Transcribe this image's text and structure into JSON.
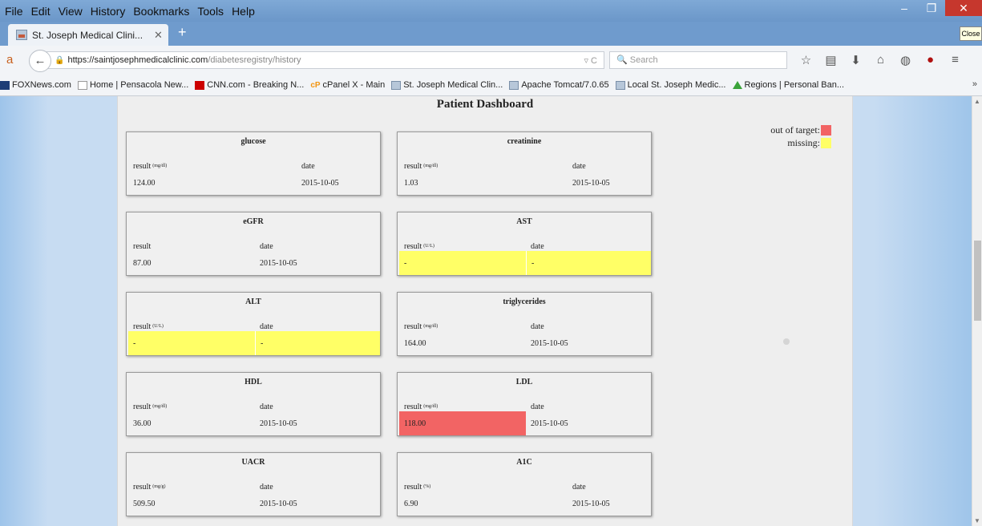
{
  "browser": {
    "menu": [
      "File",
      "Edit",
      "View",
      "History",
      "Bookmarks",
      "Tools",
      "Help"
    ],
    "tab_title": "St. Joseph Medical Clini...",
    "close_tooltip": "Close",
    "url_host": "https://saintjosephmedicalclinic.com",
    "url_path": "/diabetesregistry/history",
    "search_placeholder": "Search",
    "bookmarks": [
      "FOXNews.com",
      "Home | Pensacola New...",
      "CNN.com - Breaking N...",
      "cPanel X - Main",
      "St. Joseph Medical Clin...",
      "Apache Tomcat/7.0.65",
      "Local St. Joseph Medic...",
      "Regions | Personal Ban..."
    ]
  },
  "page": {
    "title": "Patient Dashboard",
    "legend": {
      "out_of_target": "out of target:",
      "missing": "missing:"
    },
    "colors": {
      "out_of_target": "#f26464",
      "missing": "#ffff66"
    }
  },
  "cards": [
    {
      "title": "glucose",
      "result_label": "result",
      "unit": "(mg/dl)",
      "date_label": "date",
      "result": "124.00",
      "date": "2015-10-05",
      "status": "ok"
    },
    {
      "title": "creatinine",
      "result_label": "result",
      "unit": "(mg/dl)",
      "date_label": "date",
      "result": "1.03",
      "date": "2015-10-05",
      "status": "ok"
    },
    {
      "title": "eGFR",
      "result_label": "result",
      "unit": "",
      "date_label": "date",
      "result": "87.00",
      "date": "2015-10-05",
      "status": "ok"
    },
    {
      "title": "AST",
      "result_label": "result",
      "unit": "(U/L)",
      "date_label": "date",
      "result": "-",
      "date": "-",
      "status": "missing"
    },
    {
      "title": "ALT",
      "result_label": "result",
      "unit": "(U/L)",
      "date_label": "date",
      "result": "-",
      "date": "-",
      "status": "missing"
    },
    {
      "title": "triglycerides",
      "result_label": "result",
      "unit": "(mg/dl)",
      "date_label": "date",
      "result": "164.00",
      "date": "2015-10-05",
      "status": "ok"
    },
    {
      "title": "HDL",
      "result_label": "result",
      "unit": "(mg/dl)",
      "date_label": "date",
      "result": "36.00",
      "date": "2015-10-05",
      "status": "ok"
    },
    {
      "title": "LDL",
      "result_label": "result",
      "unit": "(mg/dl)",
      "date_label": "date",
      "result": "118.00",
      "date": "2015-10-05",
      "status": "out_of_target"
    },
    {
      "title": "UACR",
      "result_label": "result",
      "unit": "(mg/g)",
      "date_label": "date",
      "result": "509.50",
      "date": "2015-10-05",
      "status": "ok"
    },
    {
      "title": "A1C",
      "result_label": "result",
      "unit": "(%)",
      "date_label": "date",
      "result": "6.90",
      "date": "2015-10-05",
      "status": "ok"
    }
  ]
}
